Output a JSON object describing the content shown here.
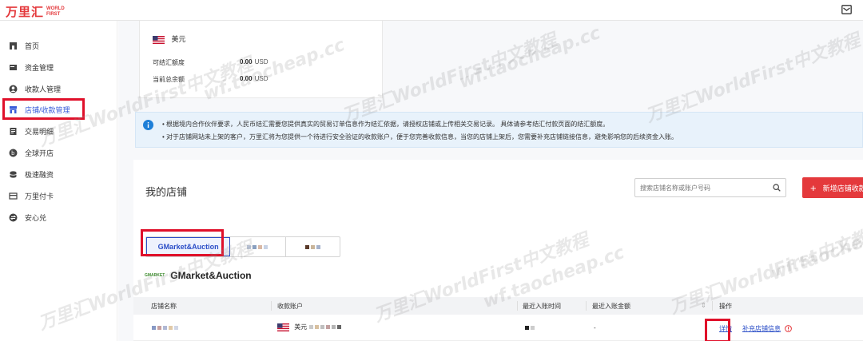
{
  "app": {
    "logo_cn": "万里汇",
    "logo_en_line1": "WORLD",
    "logo_en_line2": "FIRST"
  },
  "sidebar": {
    "items": [
      {
        "label": "首页",
        "icon": "home-icon"
      },
      {
        "label": "资金管理",
        "icon": "wallet-icon"
      },
      {
        "label": "收款人管理",
        "icon": "user-icon"
      },
      {
        "label": "店铺/收款管理",
        "icon": "store-icon",
        "active": true
      },
      {
        "label": "交易明细",
        "icon": "document-icon"
      },
      {
        "label": "全球开店",
        "icon": "globe-icon"
      },
      {
        "label": "极速融资",
        "icon": "coins-icon"
      },
      {
        "label": "万里付卡",
        "icon": "card-icon"
      },
      {
        "label": "安心兑",
        "icon": "exchange-icon"
      }
    ]
  },
  "balance": {
    "currency": "美元",
    "rows": [
      {
        "label": "可结汇额度",
        "value": "0.00",
        "unit": "USD"
      },
      {
        "label": "当前总余额",
        "value": "0.00",
        "unit": "USD"
      }
    ]
  },
  "notice": {
    "line1": "• 根据境内合作伙伴要求，人民币结汇需要您提供真实的贸易订单信息作为结汇依据，请授权店铺或上传相关交易记录。 具体请参考结汇付款页面的结汇额度。",
    "line2": "• 对于店铺网站未上架的客户，万里汇将为您提供一个待进行安全验证的收款账户，便于您完善收款信息，当您的店铺上架后，您需要补充店铺链接信息，避免影响您的后续资金入账。"
  },
  "stores": {
    "title": "我的店铺",
    "search_placeholder": "搜索店铺名称或账户号码",
    "add_button": "新增店铺收款",
    "tabs": [
      {
        "label": "GMarket&Auction",
        "active": true
      },
      {
        "label": ""
      },
      {
        "label": ""
      }
    ],
    "platform_logo": "GMARKET",
    "platform_name": "GMarket&Auction",
    "columns": [
      "店铺名称",
      "收款账户",
      "最近入账时间",
      "最近入账金额",
      "操作"
    ],
    "rows": [
      {
        "account_currency": "美元",
        "last_amount": "-",
        "detail": "详情",
        "supplement": "补充店铺信息"
      }
    ]
  },
  "colors": {
    "brand": "#e4393c",
    "link": "#2b4ec7",
    "highlight": "#e0102a"
  },
  "watermark": {
    "text1": "万里汇WorldFirst中文教程",
    "text2": "wf.taocheap.cc"
  }
}
